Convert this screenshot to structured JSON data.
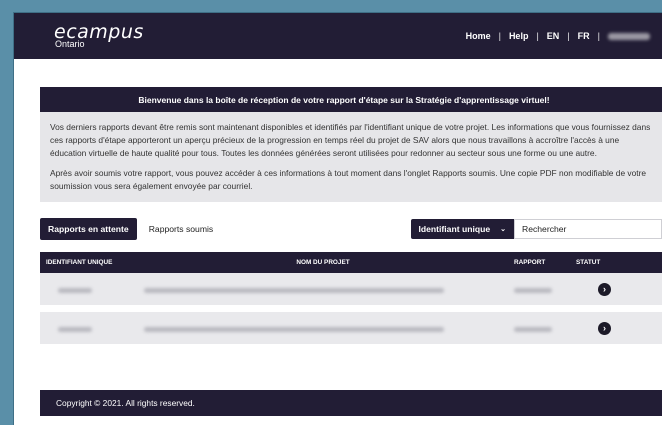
{
  "header": {
    "logo_main": "ecampus",
    "logo_sub": "Ontario",
    "nav": [
      "Home",
      "Help",
      "EN",
      "FR"
    ],
    "separator": "|"
  },
  "banner": {
    "title": "Bienvenue dans la boîte de réception de votre rapport d'étape sur la Stratégie d'apprentissage virtuel!"
  },
  "intro": {
    "p1": "Vos derniers rapports devant être remis sont maintenant disponibles et identifiés par l'identifiant unique de votre projet. Les informations que vous fournissez dans ces rapports d'étape apporteront un aperçu précieux de la progression en temps réel du projet de SAV alors que nous travaillons à accroître l'accès à une éducation virtuelle de haute qualité pour tous. Toutes les données générées seront utilisées pour redonner au secteur sous une forme ou une autre.",
    "p2": "Après avoir soumis votre rapport, vous pouvez accéder à ces informations à tout moment dans l'onglet Rapports soumis. Une copie PDF non modifiable de votre soumission vous sera également envoyée par courriel."
  },
  "tabs": {
    "pending": "Rapports en attente",
    "submitted": "Rapports soumis"
  },
  "filter": {
    "selected": "Identifiant unique",
    "chevron": "⌄",
    "search_placeholder": "Rechercher"
  },
  "table": {
    "headers": [
      "IDENTIFIANT UNIQUE",
      "NOM DU PROJET",
      "RAPPORT",
      "STATUT"
    ],
    "rows": [
      {
        "status_icon": "arrow-right-circle-icon"
      },
      {
        "status_icon": "arrow-right-circle-icon"
      }
    ]
  },
  "footer": {
    "copyright": "Copyright © 2021. All rights reserved."
  },
  "colors": {
    "primary": "#221d35",
    "panel": "#e6e6e9",
    "background": "#5a8fa8"
  }
}
